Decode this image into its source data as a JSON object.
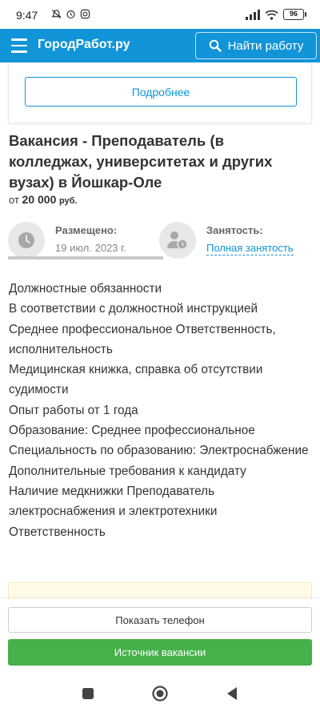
{
  "statusbar": {
    "time": "9:47",
    "battery": "96"
  },
  "header": {
    "logo": "ГородРабот.ру",
    "search_button": "Найти работу"
  },
  "top_card": {
    "details_button": "Подробнее"
  },
  "vacancy": {
    "title": "Вакансия - Преподаватель (в колледжах, университетах и других вузах) в Йошкар-Оле",
    "salary_prefix": "от",
    "salary_amount": "20 000",
    "salary_currency": "руб.",
    "posted_label": "Размещено:",
    "posted_date": "19 июл. 2023 г.",
    "employment_label": "Занятость:",
    "employment_value": "Полная занятость",
    "description": [
      "Должностные обязанности",
      "В соответствии с должностной инструкцией",
      "Среднее профессиональное Ответственность, исполнительность",
      "Медицинская книжка, справка об отсутствии судимости",
      "Опыт работы от 1 года",
      "Образование: Среднее профессиональное",
      "Специальность по образованию: Электроснабжение",
      "Дополнительные требования к кандидату",
      "Наличие медкнижки Преподаватель электроснабжения и электротехники Ответственность"
    ]
  },
  "actions": {
    "show_phone": "Показать телефон",
    "source": "Источник вакансии"
  },
  "colors": {
    "brand": "#1194d8",
    "accent_green": "#46b04a"
  },
  "icons": [
    "menu-icon",
    "search-icon",
    "clock-icon",
    "user-clock-icon",
    "nav-square-icon",
    "nav-home-icon",
    "nav-back-icon"
  ]
}
